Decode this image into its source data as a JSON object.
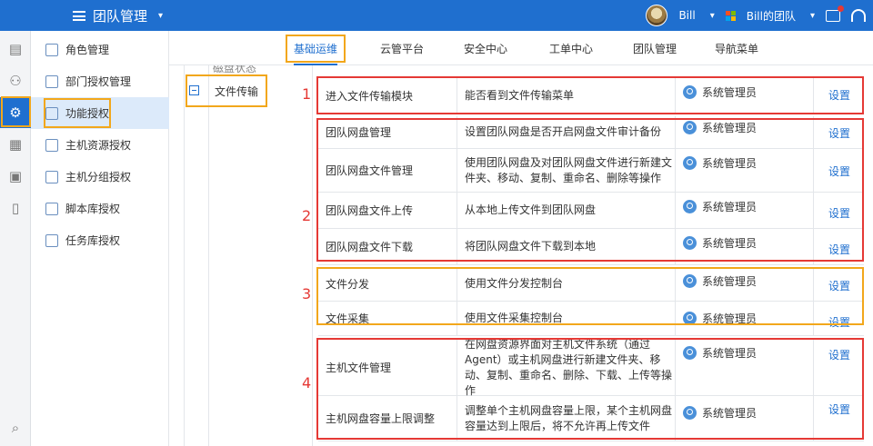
{
  "header": {
    "title": "团队管理",
    "user": "Bill",
    "team": "Bill的团队",
    "colors": {
      "brand": "#1f6fcf"
    }
  },
  "rail": {
    "icons": [
      "document-icon",
      "users-icon",
      "user-settings-icon",
      "report-icon",
      "clipboard-icon",
      "book-icon",
      "search-icon"
    ]
  },
  "sidebar": {
    "items": [
      {
        "label": "角色管理"
      },
      {
        "label": "部门授权管理"
      },
      {
        "label": "功能授权"
      },
      {
        "label": "主机资源授权"
      },
      {
        "label": "主机分组授权"
      },
      {
        "label": "脚本库授权"
      },
      {
        "label": "任务库授权"
      }
    ]
  },
  "tabs": [
    {
      "label": "基础运维"
    },
    {
      "label": "云管平台"
    },
    {
      "label": "安全中心"
    },
    {
      "label": "工单中心"
    },
    {
      "label": "团队管理"
    },
    {
      "label": "导航菜单"
    }
  ],
  "content": {
    "partial_above": "磁盘状态",
    "group": "文件传输",
    "rows": [
      {
        "name": "进入文件传输模块",
        "desc": "能否看到文件传输菜单",
        "role": "系统管理员",
        "action": "设置"
      },
      {
        "name": "团队网盘管理",
        "desc": "设置团队网盘是否开启网盘文件审计备份",
        "role": "系统管理员",
        "action": "设置"
      },
      {
        "name": "团队网盘文件管理",
        "desc": "使用团队网盘及对团队网盘文件进行新建文件夹、移动、复制、重命名、删除等操作",
        "role": "系统管理员",
        "action": "设置"
      },
      {
        "name": "团队网盘文件上传",
        "desc": "从本地上传文件到团队网盘",
        "role": "系统管理员",
        "action": "设置"
      },
      {
        "name": "团队网盘文件下载",
        "desc": "将团队网盘文件下载到本地",
        "role": "系统管理员",
        "action": "设置"
      },
      {
        "name": "文件分发",
        "desc": "使用文件分发控制台",
        "role": "系统管理员",
        "action": "设置"
      },
      {
        "name": "文件采集",
        "desc": "使用文件采集控制台",
        "role": "系统管理员",
        "action": "设置"
      },
      {
        "name": "主机文件管理",
        "desc": "在网盘资源界面对主机文件系统（通过Agent）或主机网盘进行新建文件夹、移动、复制、重命名、删除、下载、上传等操作",
        "role": "系统管理员",
        "action": "设置"
      },
      {
        "name": "主机网盘容量上限调整",
        "desc": "调整单个主机网盘容量上限，某个主机网盘容量达到上限后，将不允许再上传文件",
        "role": "系统管理员",
        "action": "设置"
      }
    ]
  },
  "annotations": {
    "labels": [
      "1",
      "2",
      "3",
      "4"
    ],
    "colors": {
      "red": "#e53935",
      "orange": "#f2a71b"
    }
  }
}
